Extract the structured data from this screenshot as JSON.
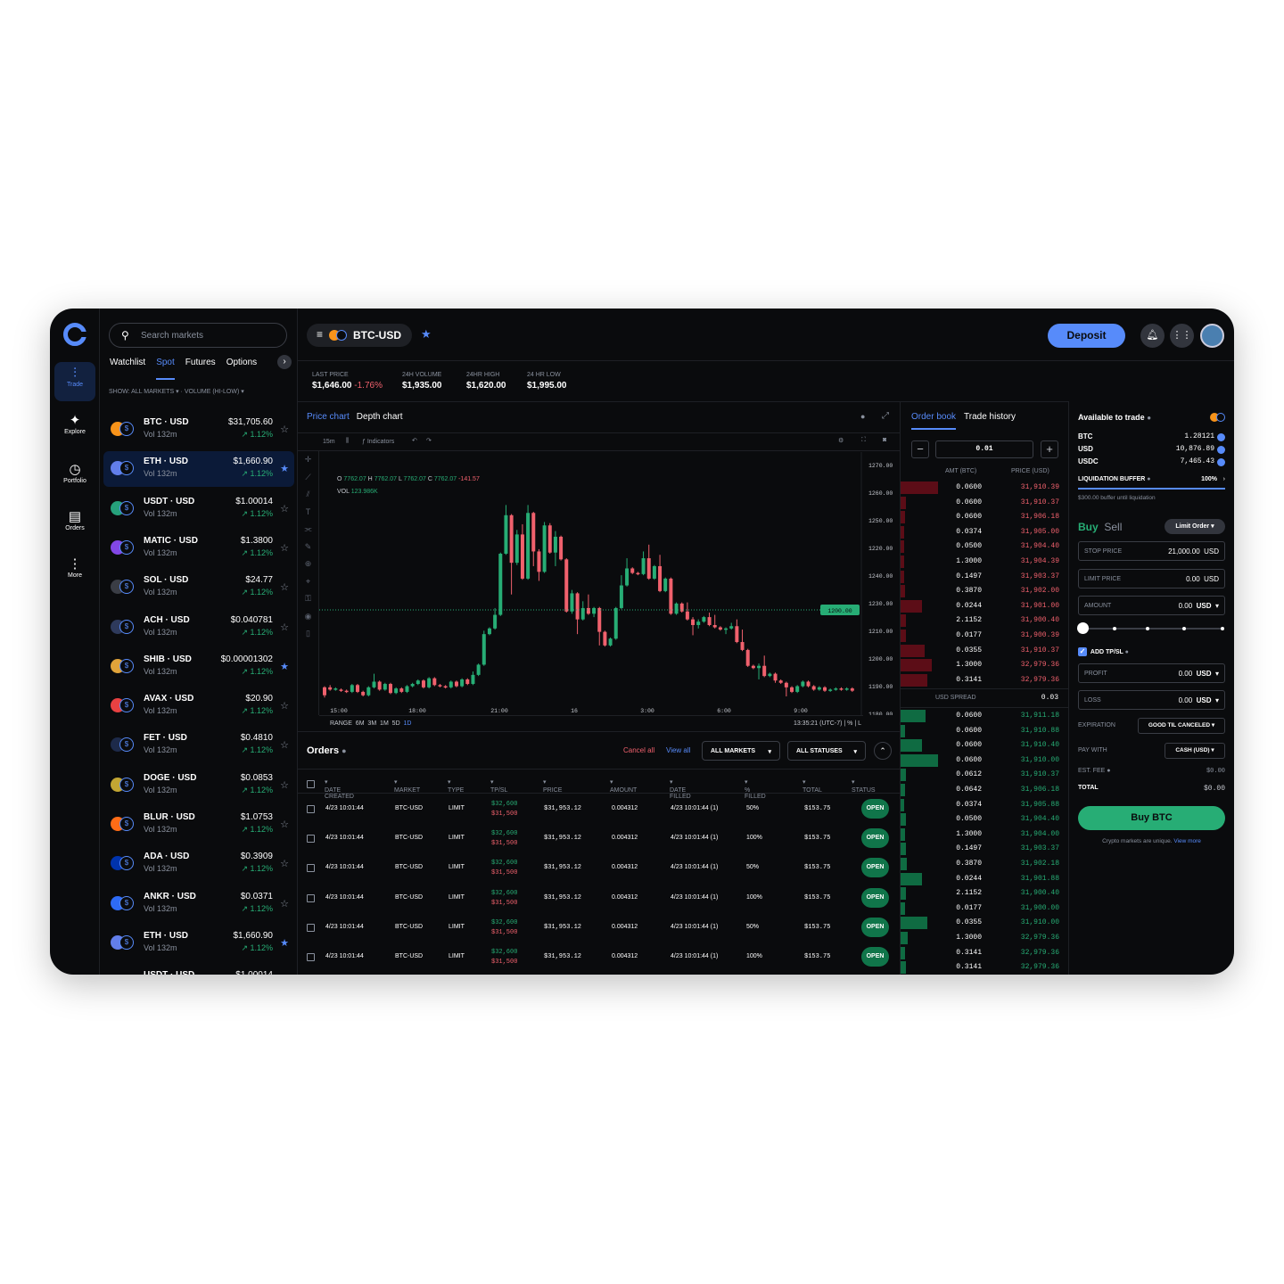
{
  "nav": {
    "items": [
      {
        "label": "Trade",
        "icon": "trade-icon"
      },
      {
        "label": "Explore",
        "icon": "explore-icon"
      },
      {
        "label": "Portfolio",
        "icon": "portfolio-icon"
      },
      {
        "label": "Orders",
        "icon": "orders-icon"
      },
      {
        "label": "More",
        "icon": "more-icon"
      }
    ]
  },
  "markets": {
    "search_placeholder": "Search markets",
    "tabs": [
      "Watchlist",
      "Spot",
      "Futures",
      "Options"
    ],
    "active_tab": "Spot",
    "show": "SHOW: ALL MARKETS",
    "sort": "VOLUME (HI-LOW)",
    "rows": [
      {
        "symbol": "BTC · USD",
        "vol": "Vol 132m",
        "price": "$31,705.60",
        "change": "↗ 1.12%",
        "coin_color": "#f7931a",
        "starred": false,
        "selected": false
      },
      {
        "symbol": "ETH · USD",
        "vol": "Vol 132m",
        "price": "$1,660.90",
        "change": "↗ 1.12%",
        "coin_color": "#627eea",
        "starred": true,
        "selected": true
      },
      {
        "symbol": "USDT · USD",
        "vol": "Vol 132m",
        "price": "$1.00014",
        "change": "↗ 1.12%",
        "coin_color": "#26a17b",
        "starred": false,
        "selected": false
      },
      {
        "symbol": "MATIC · USD",
        "vol": "Vol 132m",
        "price": "$1.3800",
        "change": "↗ 1.12%",
        "coin_color": "#8247e5",
        "starred": false,
        "selected": false
      },
      {
        "symbol": "SOL · USD",
        "vol": "Vol 132m",
        "price": "$24.77",
        "change": "↗ 1.12%",
        "coin_color": "#3a3d45",
        "starred": false,
        "selected": false
      },
      {
        "symbol": "ACH · USD",
        "vol": "Vol 132m",
        "price": "$0.040781",
        "change": "↗ 1.12%",
        "coin_color": "#2e3a5c",
        "starred": false,
        "selected": false
      },
      {
        "symbol": "SHIB · USD",
        "vol": "Vol 132m",
        "price": "$0.00001302",
        "change": "↗ 1.12%",
        "coin_color": "#e0a33a",
        "starred": true,
        "selected": false
      },
      {
        "symbol": "AVAX · USD",
        "vol": "Vol 132m",
        "price": "$20.90",
        "change": "↗ 1.12%",
        "coin_color": "#e84142",
        "starred": false,
        "selected": false
      },
      {
        "symbol": "FET · USD",
        "vol": "Vol 132m",
        "price": "$0.4810",
        "change": "↗ 1.12%",
        "coin_color": "#1d2a4a",
        "starred": false,
        "selected": false
      },
      {
        "symbol": "DOGE · USD",
        "vol": "Vol 132m",
        "price": "$0.0853",
        "change": "↗ 1.12%",
        "coin_color": "#c2a633",
        "starred": false,
        "selected": false
      },
      {
        "symbol": "BLUR · USD",
        "vol": "Vol 132m",
        "price": "$1.0753",
        "change": "↗ 1.12%",
        "coin_color": "#ff6c17",
        "starred": false,
        "selected": false
      },
      {
        "symbol": "ADA · USD",
        "vol": "Vol 132m",
        "price": "$0.3909",
        "change": "↗ 1.12%",
        "coin_color": "#0033ad",
        "starred": false,
        "selected": false
      },
      {
        "symbol": "ANKR · USD",
        "vol": "Vol 132m",
        "price": "$0.0371",
        "change": "↗ 1.12%",
        "coin_color": "#2e6bf6",
        "starred": false,
        "selected": false
      },
      {
        "symbol": "ETH · USD",
        "vol": "Vol 132m",
        "price": "$1,660.90",
        "change": "↗ 1.12%",
        "coin_color": "#627eea",
        "starred": true,
        "selected": false
      },
      {
        "symbol": "USDT · USD",
        "vol": "",
        "price": "$1.00014",
        "change": "",
        "coin_color": "#26a17b",
        "starred": false,
        "selected": false
      }
    ]
  },
  "header": {
    "pair": "BTC-USD",
    "deposit": "Deposit"
  },
  "stats": [
    {
      "label": "LAST PRICE",
      "value": "$1,646.00",
      "change": "-1.76%"
    },
    {
      "label": "24H VOLUME",
      "value": "$1,935.00"
    },
    {
      "label": "24HR HIGH",
      "value": "$1,620.00"
    },
    {
      "label": "24 HR LOW",
      "value": "$1,995.00"
    }
  ],
  "chart_panel": {
    "tabs": [
      "Price chart",
      "Depth chart"
    ],
    "interval": "15m",
    "indicators": "Indicators",
    "ohlc": {
      "o_label": "O",
      "o": "7762.07",
      "h_label": "H",
      "h": "7762.07",
      "l_label": "L",
      "l": "7762.07",
      "c_label": "C",
      "c": "7762.07",
      "change": "-141.57"
    },
    "vol_label": "VOL",
    "vol": "123.986K",
    "range_label": "RANGE",
    "ranges": [
      "6M",
      "3M",
      "1M",
      "5D",
      "1D"
    ],
    "active_range": "1D",
    "time_readout": "13:35:21 (UTC-7)",
    "percent_label": "%",
    "log_label": "L"
  },
  "chart_data": {
    "type": "candlestick",
    "x_ticks": [
      "15:00",
      "18:00",
      "21:00",
      "16",
      "3:00",
      "6:00",
      "9:00"
    ],
    "y_ticks": [
      "1270.00",
      "1260.00",
      "1250.00",
      "1220.00",
      "1240.00",
      "1230.00",
      "1210.00",
      "1200.00",
      "1190.00",
      "1180.00"
    ],
    "price_line_label": "1200.00",
    "colors": {
      "up": "#27ad75",
      "down": "#f0616d"
    },
    "candles": [
      [
        0,
        8,
        1,
        9,
        -1
      ],
      [
        1,
        8,
        6,
        10,
        5
      ],
      [
        2,
        6,
        7,
        8,
        5
      ],
      [
        3,
        6,
        5,
        7,
        4
      ],
      [
        4,
        5,
        4,
        6,
        3
      ],
      [
        5,
        4,
        10,
        11,
        3
      ],
      [
        6,
        10,
        4,
        11,
        3
      ],
      [
        7,
        4,
        1,
        5,
        0
      ],
      [
        8,
        1,
        8,
        9,
        0
      ],
      [
        9,
        8,
        13,
        20,
        7
      ],
      [
        10,
        13,
        6,
        14,
        5
      ],
      [
        11,
        6,
        11,
        12,
        5
      ],
      [
        12,
        11,
        3,
        12,
        2
      ],
      [
        13,
        3,
        7,
        8,
        2
      ],
      [
        14,
        7,
        4,
        8,
        3
      ],
      [
        15,
        4,
        9,
        10,
        3
      ],
      [
        16,
        9,
        11,
        12,
        8
      ],
      [
        17,
        11,
        14,
        15,
        10
      ],
      [
        18,
        14,
        8,
        15,
        7
      ],
      [
        19,
        8,
        16,
        17,
        7
      ],
      [
        20,
        16,
        10,
        17,
        9
      ],
      [
        21,
        10,
        9,
        11,
        8
      ],
      [
        22,
        9,
        8,
        10,
        7
      ],
      [
        23,
        8,
        13,
        14,
        7
      ],
      [
        24,
        13,
        9,
        14,
        8
      ],
      [
        25,
        9,
        15,
        16,
        8
      ],
      [
        26,
        15,
        11,
        16,
        10
      ],
      [
        27,
        11,
        19,
        22,
        10
      ],
      [
        28,
        19,
        28,
        29,
        18
      ],
      [
        29,
        28,
        55,
        58,
        27
      ],
      [
        30,
        55,
        60,
        61,
        54
      ],
      [
        31,
        60,
        72,
        78,
        59
      ],
      [
        32,
        72,
        126,
        127,
        71
      ],
      [
        33,
        126,
        160,
        169,
        125
      ],
      [
        34,
        160,
        118,
        161,
        90
      ],
      [
        35,
        118,
        143,
        147,
        116
      ],
      [
        36,
        143,
        104,
        152,
        103
      ],
      [
        37,
        104,
        162,
        169,
        103
      ],
      [
        38,
        162,
        128,
        163,
        115
      ],
      [
        39,
        128,
        110,
        130,
        102
      ],
      [
        40,
        110,
        151,
        154,
        109
      ],
      [
        41,
        151,
        127,
        153,
        126
      ],
      [
        42,
        127,
        141,
        146,
        115
      ],
      [
        43,
        141,
        121,
        142,
        120
      ],
      [
        44,
        121,
        75,
        122,
        74
      ],
      [
        45,
        75,
        91,
        94,
        73
      ],
      [
        46,
        91,
        68,
        92,
        55
      ],
      [
        47,
        68,
        78,
        84,
        67
      ],
      [
        48,
        78,
        73,
        90,
        72
      ],
      [
        49,
        73,
        78,
        79,
        70
      ],
      [
        50,
        78,
        57,
        79,
        45
      ],
      [
        51,
        57,
        45,
        58,
        44
      ],
      [
        52,
        45,
        51,
        52,
        44
      ],
      [
        53,
        51,
        78,
        79,
        50
      ],
      [
        54,
        78,
        98,
        107,
        77
      ],
      [
        55,
        98,
        113,
        122,
        97
      ],
      [
        56,
        113,
        109,
        114,
        108
      ],
      [
        57,
        109,
        108,
        110,
        107
      ],
      [
        58,
        108,
        122,
        128,
        107
      ],
      [
        59,
        122,
        104,
        134,
        103
      ],
      [
        60,
        104,
        115,
        116,
        103
      ],
      [
        61,
        115,
        93,
        125,
        92
      ],
      [
        62,
        93,
        104,
        105,
        92
      ],
      [
        63,
        104,
        73,
        105,
        72
      ],
      [
        64,
        73,
        82,
        83,
        72
      ],
      [
        65,
        82,
        75,
        83,
        74
      ],
      [
        66,
        75,
        68,
        83,
        67
      ],
      [
        67,
        68,
        63,
        70,
        54
      ],
      [
        68,
        63,
        66,
        68,
        60
      ],
      [
        69,
        66,
        70,
        71,
        65
      ],
      [
        70,
        70,
        63,
        74,
        62
      ],
      [
        71,
        63,
        61,
        72,
        60
      ],
      [
        72,
        61,
        59,
        62,
        58
      ],
      [
        73,
        59,
        60,
        61,
        55
      ],
      [
        74,
        60,
        62,
        65,
        59
      ],
      [
        75,
        62,
        48,
        68,
        47
      ],
      [
        76,
        48,
        41,
        59,
        40
      ],
      [
        77,
        41,
        27,
        42,
        26
      ],
      [
        78,
        27,
        25,
        28,
        24
      ],
      [
        79,
        25,
        27,
        29,
        15
      ],
      [
        80,
        27,
        18,
        36,
        17
      ],
      [
        81,
        18,
        20,
        21,
        17
      ],
      [
        82,
        20,
        14,
        21,
        12
      ],
      [
        83,
        14,
        12,
        15,
        11
      ],
      [
        84,
        12,
        8,
        13,
        0
      ],
      [
        85,
        8,
        4,
        9,
        3
      ],
      [
        86,
        4,
        9,
        10,
        3
      ],
      [
        87,
        9,
        13,
        14,
        8
      ],
      [
        88,
        13,
        9,
        14,
        8
      ],
      [
        89,
        9,
        6,
        10,
        5
      ],
      [
        90,
        6,
        8,
        9,
        5
      ],
      [
        91,
        8,
        5,
        9,
        4
      ],
      [
        92,
        5,
        6,
        7,
        4
      ],
      [
        93,
        6,
        7,
        8,
        5
      ],
      [
        94,
        7,
        6,
        8,
        5
      ],
      [
        95,
        6,
        7,
        8,
        5
      ],
      [
        96,
        7,
        5,
        8,
        4
      ]
    ]
  },
  "orders": {
    "title": "Orders",
    "cancel_all": "Cancel all",
    "view_all": "View all",
    "markets_filter": "ALL MARKETS",
    "status_filter": "ALL STATUSES",
    "columns": [
      "DATE CREATED",
      "MARKET",
      "TYPE",
      "TP/SL",
      "PRICE",
      "AMOUNT",
      "DATE FILLED",
      "% FILLED",
      "TOTAL",
      "STATUS"
    ],
    "rows": [
      {
        "date": "4/23 10:01:44",
        "market": "BTC-USD",
        "type": "LIMIT",
        "tp": "$32,600",
        "sl": "$31,500",
        "price": "$31,953.12",
        "amount": "0.004312",
        "filled_date": "4/23 10:01:44 (1)",
        "filled": "50%",
        "total": "$153.75",
        "status": "OPEN"
      },
      {
        "date": "4/23 10:01:44",
        "market": "BTC-USD",
        "type": "LIMIT",
        "tp": "$32,600",
        "sl": "$31,500",
        "price": "$31,953.12",
        "amount": "0.004312",
        "filled_date": "4/23 10:01:44 (1)",
        "filled": "100%",
        "total": "$153.75",
        "status": "OPEN"
      },
      {
        "date": "4/23 10:01:44",
        "market": "BTC-USD",
        "type": "LIMIT",
        "tp": "$32,600",
        "sl": "$31,500",
        "price": "$31,953.12",
        "amount": "0.004312",
        "filled_date": "4/23 10:01:44 (1)",
        "filled": "50%",
        "total": "$153.75",
        "status": "OPEN"
      },
      {
        "date": "4/23 10:01:44",
        "market": "BTC-USD",
        "type": "LIMIT",
        "tp": "$32,600",
        "sl": "$31,500",
        "price": "$31,953.12",
        "amount": "0.004312",
        "filled_date": "4/23 10:01:44 (1)",
        "filled": "100%",
        "total": "$153.75",
        "status": "OPEN"
      },
      {
        "date": "4/23 10:01:44",
        "market": "BTC-USD",
        "type": "LIMIT",
        "tp": "$32,600",
        "sl": "$31,500",
        "price": "$31,953.12",
        "amount": "0.004312",
        "filled_date": "4/23 10:01:44 (1)",
        "filled": "50%",
        "total": "$153.75",
        "status": "OPEN"
      },
      {
        "date": "4/23 10:01:44",
        "market": "BTC-USD",
        "type": "LIMIT",
        "tp": "$32,600",
        "sl": "$31,500",
        "price": "$31,953.12",
        "amount": "0.004312",
        "filled_date": "4/23 10:01:44 (1)",
        "filled": "100%",
        "total": "$153.75",
        "status": "OPEN"
      }
    ]
  },
  "orderbook": {
    "tabs": [
      "Order book",
      "Trade history"
    ],
    "increment": "0.01",
    "amt_header": "AMT (BTC)",
    "price_header": "PRICE (USD)",
    "spread_label": "USD SPREAD",
    "spread": "0.03",
    "asks": [
      {
        "amt": "0.0600",
        "price": "31,910.39",
        "depth": 0.42
      },
      {
        "amt": "0.0600",
        "price": "31,910.37",
        "depth": 0.06
      },
      {
        "amt": "0.0600",
        "price": "31,906.18",
        "depth": 0.05
      },
      {
        "amt": "0.0374",
        "price": "31,905.00",
        "depth": 0.04
      },
      {
        "amt": "0.0500",
        "price": "31,904.40",
        "depth": 0.04
      },
      {
        "amt": "1.3000",
        "price": "31,904.39",
        "depth": 0.04
      },
      {
        "amt": "0.1497",
        "price": "31,903.37",
        "depth": 0.04
      },
      {
        "amt": "0.3870",
        "price": "31,902.00",
        "depth": 0.05
      },
      {
        "amt": "0.0244",
        "price": "31,901.00",
        "depth": 0.24
      },
      {
        "amt": "2.1152",
        "price": "31,900.40",
        "depth": 0.06
      },
      {
        "amt": "0.0177",
        "price": "31,900.39",
        "depth": 0.06
      },
      {
        "amt": "0.0355",
        "price": "31,910.37",
        "depth": 0.27
      },
      {
        "amt": "1.3000",
        "price": "32,979.36",
        "depth": 0.35
      },
      {
        "amt": "0.3141",
        "price": "32,979.36",
        "depth": 0.3
      }
    ],
    "bids": [
      {
        "amt": "0.0600",
        "price": "31,911.18",
        "depth": 0.28
      },
      {
        "amt": "0.0600",
        "price": "31,910.88",
        "depth": 0.05
      },
      {
        "amt": "0.0600",
        "price": "31,910.40",
        "depth": 0.24
      },
      {
        "amt": "0.0600",
        "price": "31,910.00",
        "depth": 0.42
      },
      {
        "amt": "0.0612",
        "price": "31,910.37",
        "depth": 0.06
      },
      {
        "amt": "0.0642",
        "price": "31,906.18",
        "depth": 0.05
      },
      {
        "amt": "0.0374",
        "price": "31,905.88",
        "depth": 0.04
      },
      {
        "amt": "0.0500",
        "price": "31,904.40",
        "depth": 0.06
      },
      {
        "amt": "1.3000",
        "price": "31,904.00",
        "depth": 0.05
      },
      {
        "amt": "0.1497",
        "price": "31,903.37",
        "depth": 0.06
      },
      {
        "amt": "0.3870",
        "price": "31,902.18",
        "depth": 0.07
      },
      {
        "amt": "0.0244",
        "price": "31,901.88",
        "depth": 0.24
      },
      {
        "amt": "2.1152",
        "price": "31,900.40",
        "depth": 0.06
      },
      {
        "amt": "0.0177",
        "price": "31,900.00",
        "depth": 0.05
      },
      {
        "amt": "0.0355",
        "price": "31,910.00",
        "depth": 0.3
      },
      {
        "amt": "1.3000",
        "price": "32,979.36",
        "depth": 0.08
      },
      {
        "amt": "0.3141",
        "price": "32,979.36",
        "depth": 0.05
      },
      {
        "amt": "0.3141",
        "price": "32,979.36",
        "depth": 0.06
      }
    ]
  },
  "trade": {
    "available_label": "Available to trade",
    "balances": [
      {
        "asset": "BTC",
        "amount": "1.28121"
      },
      {
        "asset": "USD",
        "amount": "10,876.89"
      },
      {
        "asset": "USDC",
        "amount": "7,465.43"
      }
    ],
    "liq_label": "LIQUIDATION BUFFER",
    "liq_value": "100%",
    "liq_fill": 1.0,
    "liq_note": "$300.00 buffer until liquidation",
    "buy": "Buy",
    "sell": "Sell",
    "order_type": "Limit Order",
    "stop_label": "STOP PRICE",
    "stop_value": "21,000.00",
    "stop_unit": "USD",
    "limit_label": "LIMIT PRICE",
    "limit_value": "0.00",
    "limit_unit": "USD",
    "amount_label": "AMOUNT",
    "amount_value": "0.00",
    "amount_unit": "USD",
    "amount_slider": 0.0,
    "tpsl_label": "ADD TP/SL",
    "profit_label": "PROFIT",
    "profit_value": "0.00",
    "profit_unit": "USD",
    "loss_label": "LOSS",
    "loss_value": "0.00",
    "loss_unit": "USD",
    "expiration_label": "EXPIRATION",
    "expiration_value": "GOOD TIL CANCELED",
    "pay_label": "PAY WITH",
    "pay_value": "CASH (USD)",
    "fee_label": "EST. FEE",
    "fee_value": "$0.00",
    "total_label": "TOTAL",
    "total_value": "$0.00",
    "buy_button": "Buy BTC",
    "note": "Crypto markets are unique.",
    "note_link": "View more"
  }
}
